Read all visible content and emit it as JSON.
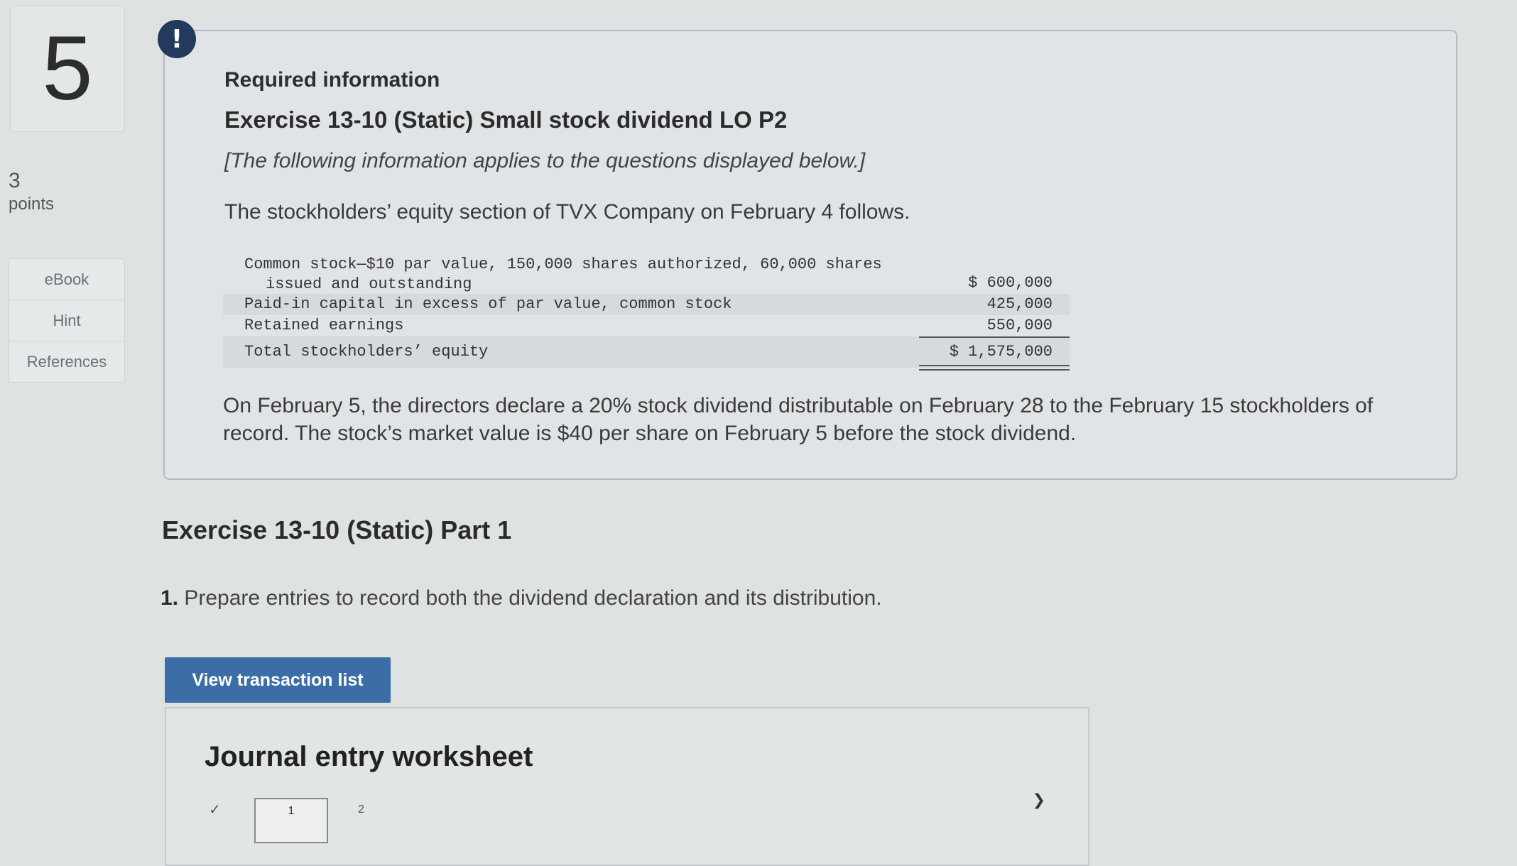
{
  "question": {
    "number": "5",
    "points_value": "3",
    "points_label": "points"
  },
  "sidebar": {
    "tools": [
      "eBook",
      "Hint",
      "References"
    ]
  },
  "alert_icon": "!",
  "info": {
    "heading": "Required information",
    "exercise_title": "Exercise 13-10 (Static) Small stock dividend LO P2",
    "note": "[The following information applies to the questions displayed below.]",
    "intro": "The stockholders’ equity section of TVX Company on February 4 follows.",
    "equity_table": {
      "rows": [
        {
          "label_line1": "Common stock—$10 par value, 150,000 shares authorized, 60,000 shares",
          "label_line2": "issued and outstanding",
          "amount": "$ 600,000"
        },
        {
          "label": "Paid-in capital in excess of par value, common stock",
          "amount": "425,000"
        },
        {
          "label": "Retained earnings",
          "amount": "550,000"
        },
        {
          "label": "Total stockholders’ equity",
          "amount": "$ 1,575,000"
        }
      ]
    },
    "declaration": "On February 5, the directors declare a 20% stock dividend distributable on February 28 to the February 15 stockholders of record. The stock’s market value is $40 per share on February 5 before the stock dividend."
  },
  "part": {
    "title": "Exercise 13-10 (Static) Part 1",
    "question_number": "1.",
    "question_text": "Prepare entries to record both the dividend declaration and its distribution."
  },
  "buttons": {
    "view_transactions": "View transaction list"
  },
  "worksheet": {
    "title": "Journal entry worksheet",
    "tab1": "1",
    "tab2": "2"
  }
}
